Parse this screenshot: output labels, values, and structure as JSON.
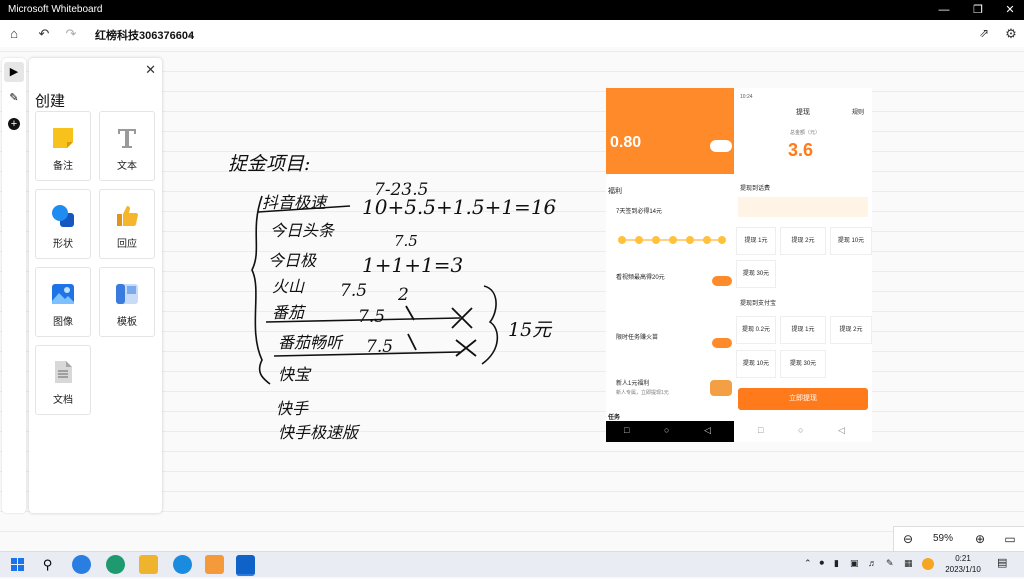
{
  "titlebar": {
    "title": "Microsoft Whiteboard"
  },
  "appbar": {
    "board_name": "红榜科技306376604"
  },
  "panel": {
    "heading": "创建",
    "tiles": [
      {
        "label": "备注",
        "icon": "sticky-note-icon",
        "color": "#f7c21c"
      },
      {
        "label": "文本",
        "icon": "text-icon",
        "color": "#9a9a9a"
      },
      {
        "label": "形状",
        "icon": "shapes-icon",
        "color": "#1e74e6"
      },
      {
        "label": "回应",
        "icon": "thumbs-up-icon",
        "color": "#f2a81e"
      },
      {
        "label": "图像",
        "icon": "image-icon",
        "color": "#1e74e6"
      },
      {
        "label": "模板",
        "icon": "template-icon",
        "color": "#3a7be0"
      },
      {
        "label": "文档",
        "icon": "document-icon",
        "color": "#8c8c8c"
      }
    ]
  },
  "phone_left": {
    "balance": "0.80",
    "section": "福利",
    "tasks": [
      {
        "title": "7天签到必得14元"
      },
      {
        "title": "看视频最高得20元"
      },
      {
        "title": "限时任务赚火苗"
      },
      {
        "title": "新人1元福利",
        "sub": "新人专属，立即提现1元"
      }
    ],
    "footer": "任务"
  },
  "phone_right": {
    "time": "10:24",
    "title": "提现",
    "rule": "规则",
    "balance_label": "总金额（元）",
    "balance": "3.6",
    "section1": "提现到话费",
    "section2": "提现到支付宝",
    "amounts1": [
      "提现 1元",
      "提现 2元",
      "提现 10元",
      "提现 30元"
    ],
    "amounts2": [
      "提现 0.2元",
      "提现 1元",
      "提现 2元",
      "提现 10元",
      "提现 30元"
    ],
    "cta": "立即提现"
  },
  "handwriting": {
    "title": "捉金项目:",
    "lines": [
      "抖音极速",
      "今日头条",
      "今日极",
      "火山",
      "番茄",
      "番茄畅听",
      "快宝",
      "快手",
      "快手极速版"
    ],
    "eq1": "7-23.5",
    "eq2": "10+5.5+1.5+1=16",
    "eq3": "1+1+1=3",
    "n75a": "7.5",
    "n75b": "7.5",
    "n75c": "7.5",
    "n75d": "7.5",
    "n2": "2",
    "total": "15元"
  },
  "zoom": {
    "level": "59%"
  },
  "taskbar": {
    "time": "0:21",
    "date": "2023/1/10"
  }
}
